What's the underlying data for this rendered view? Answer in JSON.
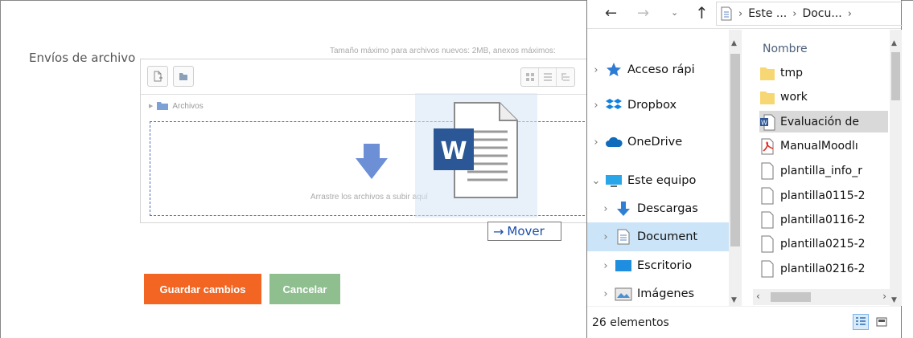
{
  "form": {
    "field_label": "Envíos de archivo",
    "max_size_text": "Tamaño máximo para archivos nuevos: 2MB, anexos máximos:",
    "path_label": "Archivos",
    "drop_text": "Arrastre los archivos a subir aquí",
    "move_tooltip": "Mover",
    "save_label": "Guardar cambios",
    "cancel_label": "Cancelar"
  },
  "explorer": {
    "breadcrumb": [
      "Este ...",
      "Docu..."
    ],
    "nav_items": [
      {
        "label": "Acceso rápi",
        "icon": "star-icon"
      },
      {
        "label": "Dropbox",
        "icon": "dropbox-icon"
      },
      {
        "label": "OneDrive",
        "icon": "cloud-icon"
      },
      {
        "label": "Este equipo",
        "icon": "computer-icon"
      },
      {
        "label": "Descargas",
        "icon": "download-icon"
      },
      {
        "label": "Document",
        "icon": "documents-icon"
      },
      {
        "label": "Escritorio",
        "icon": "desktop-icon"
      },
      {
        "label": "Imágenes",
        "icon": "pictures-icon"
      }
    ],
    "column_header": "Nombre",
    "files": [
      {
        "label": "tmp",
        "icon": "folder-icon"
      },
      {
        "label": "work",
        "icon": "folder-icon"
      },
      {
        "label": "Evaluación de",
        "icon": "word-file-icon"
      },
      {
        "label": "ManualMoodlı",
        "icon": "pdf-file-icon"
      },
      {
        "label": "plantilla_info_r",
        "icon": "file-icon"
      },
      {
        "label": "plantilla0115-2",
        "icon": "file-icon"
      },
      {
        "label": "plantilla0116-2",
        "icon": "file-icon"
      },
      {
        "label": "plantilla0215-2",
        "icon": "file-icon"
      },
      {
        "label": "plantilla0216-2",
        "icon": "file-icon"
      }
    ],
    "status": "26 elementos"
  },
  "colors": {
    "save_button": "#f26522",
    "cancel_button": "#8fbf8f",
    "dropzone_border": "#4f6fb8",
    "selection": "#cce4f7"
  }
}
